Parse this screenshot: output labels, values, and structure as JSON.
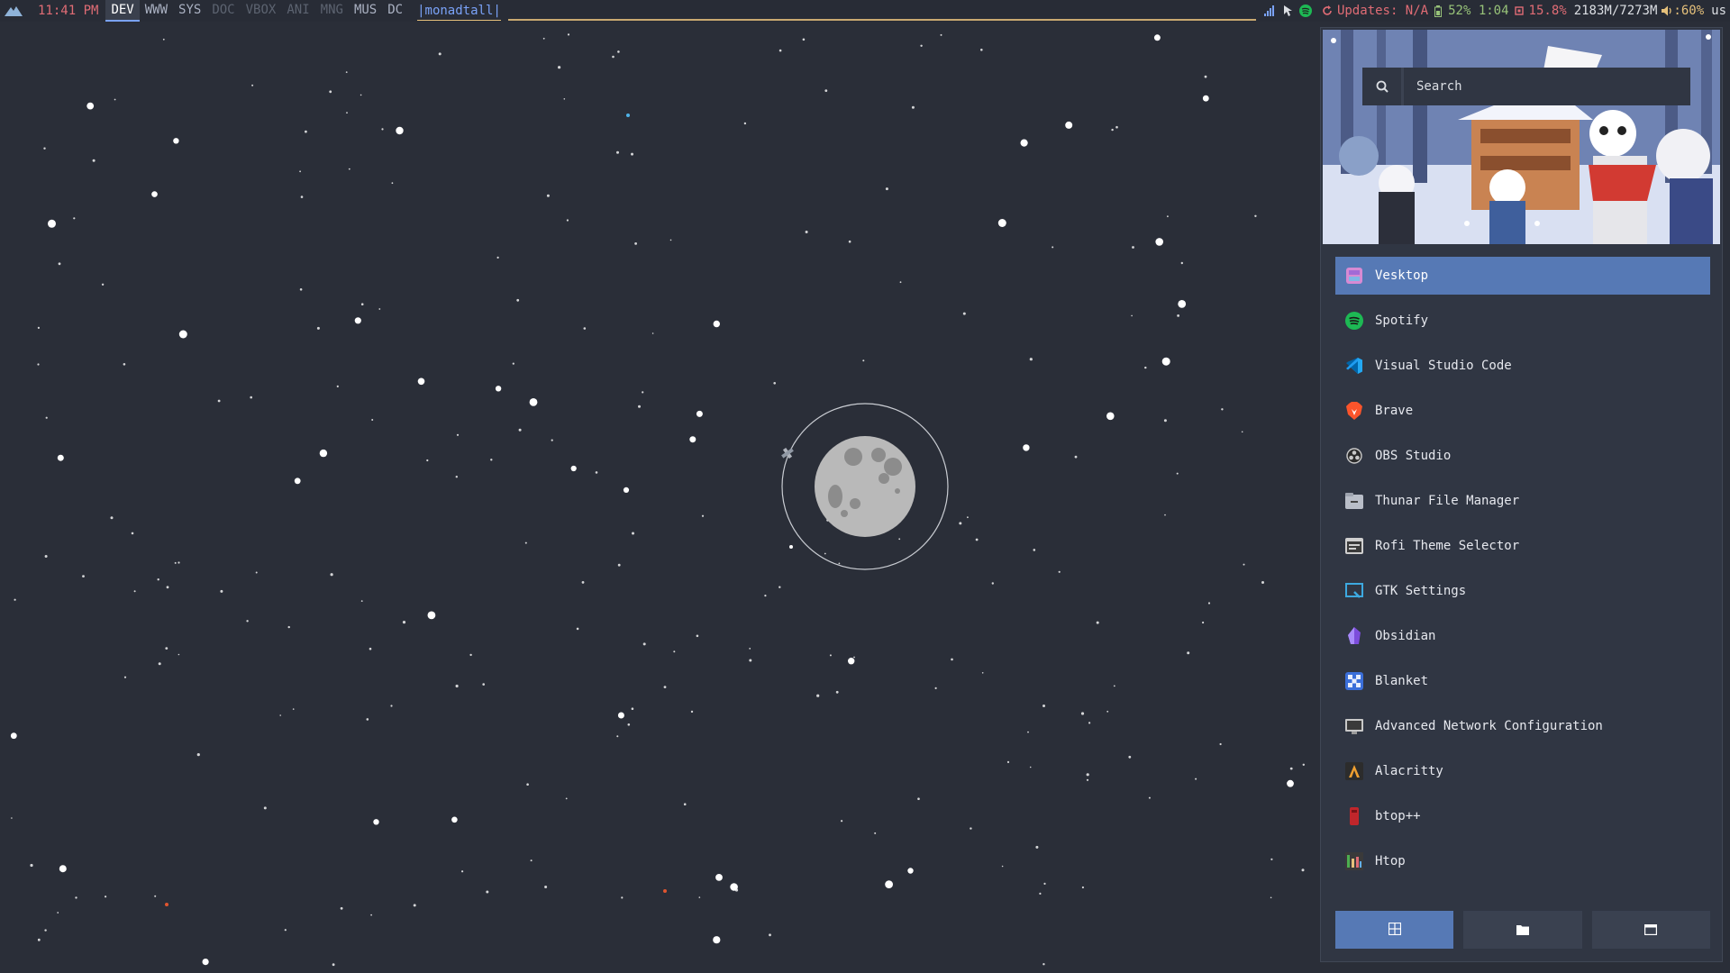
{
  "topbar": {
    "clock": "11:41 PM",
    "workspaces": [
      {
        "label": "DEV",
        "state": "active"
      },
      {
        "label": "WWW",
        "state": "occupied"
      },
      {
        "label": "SYS",
        "state": "occupied"
      },
      {
        "label": "DOC",
        "state": "empty"
      },
      {
        "label": "VBOX",
        "state": "empty"
      },
      {
        "label": "ANI",
        "state": "empty"
      },
      {
        "label": "MNG",
        "state": "empty"
      },
      {
        "label": "MUS",
        "state": "occupied"
      },
      {
        "label": "DC",
        "state": "occupied"
      }
    ],
    "layout": "|monadtall|",
    "updates": "Updates: N/A",
    "battery": "52% 1:04",
    "cpu": "15.8%",
    "memory": "2183M/7273M",
    "volume": ":60%",
    "keyboard": "us",
    "colors": {
      "accent": "#7aa2f7",
      "red": "#e06c75",
      "green": "#98c379",
      "yellow": "#e5c07b"
    }
  },
  "launcher": {
    "search_placeholder": "Search",
    "apps": [
      {
        "label": "Vesktop",
        "icon": "vesktop-icon",
        "selected": true
      },
      {
        "label": "Spotify",
        "icon": "spotify-icon"
      },
      {
        "label": "Visual Studio Code",
        "icon": "vscode-icon"
      },
      {
        "label": "Brave",
        "icon": "brave-icon"
      },
      {
        "label": "OBS Studio",
        "icon": "obs-icon"
      },
      {
        "label": "Thunar File Manager",
        "icon": "thunar-icon"
      },
      {
        "label": "Rofi Theme Selector",
        "icon": "rofi-icon"
      },
      {
        "label": "GTK Settings",
        "icon": "gtk-settings-icon"
      },
      {
        "label": "Obsidian",
        "icon": "obsidian-icon"
      },
      {
        "label": "Blanket",
        "icon": "blanket-icon"
      },
      {
        "label": "Advanced Network Configuration",
        "icon": "network-icon"
      },
      {
        "label": "Alacritty",
        "icon": "alacritty-icon"
      },
      {
        "label": "btop++",
        "icon": "btop-icon"
      },
      {
        "label": "Htop",
        "icon": "htop-icon"
      }
    ],
    "modes": [
      {
        "icon": "apps-grid-icon",
        "active": true
      },
      {
        "icon": "folder-icon",
        "active": false
      },
      {
        "icon": "window-icon",
        "active": false
      }
    ],
    "selection_color": "#5679b5"
  }
}
